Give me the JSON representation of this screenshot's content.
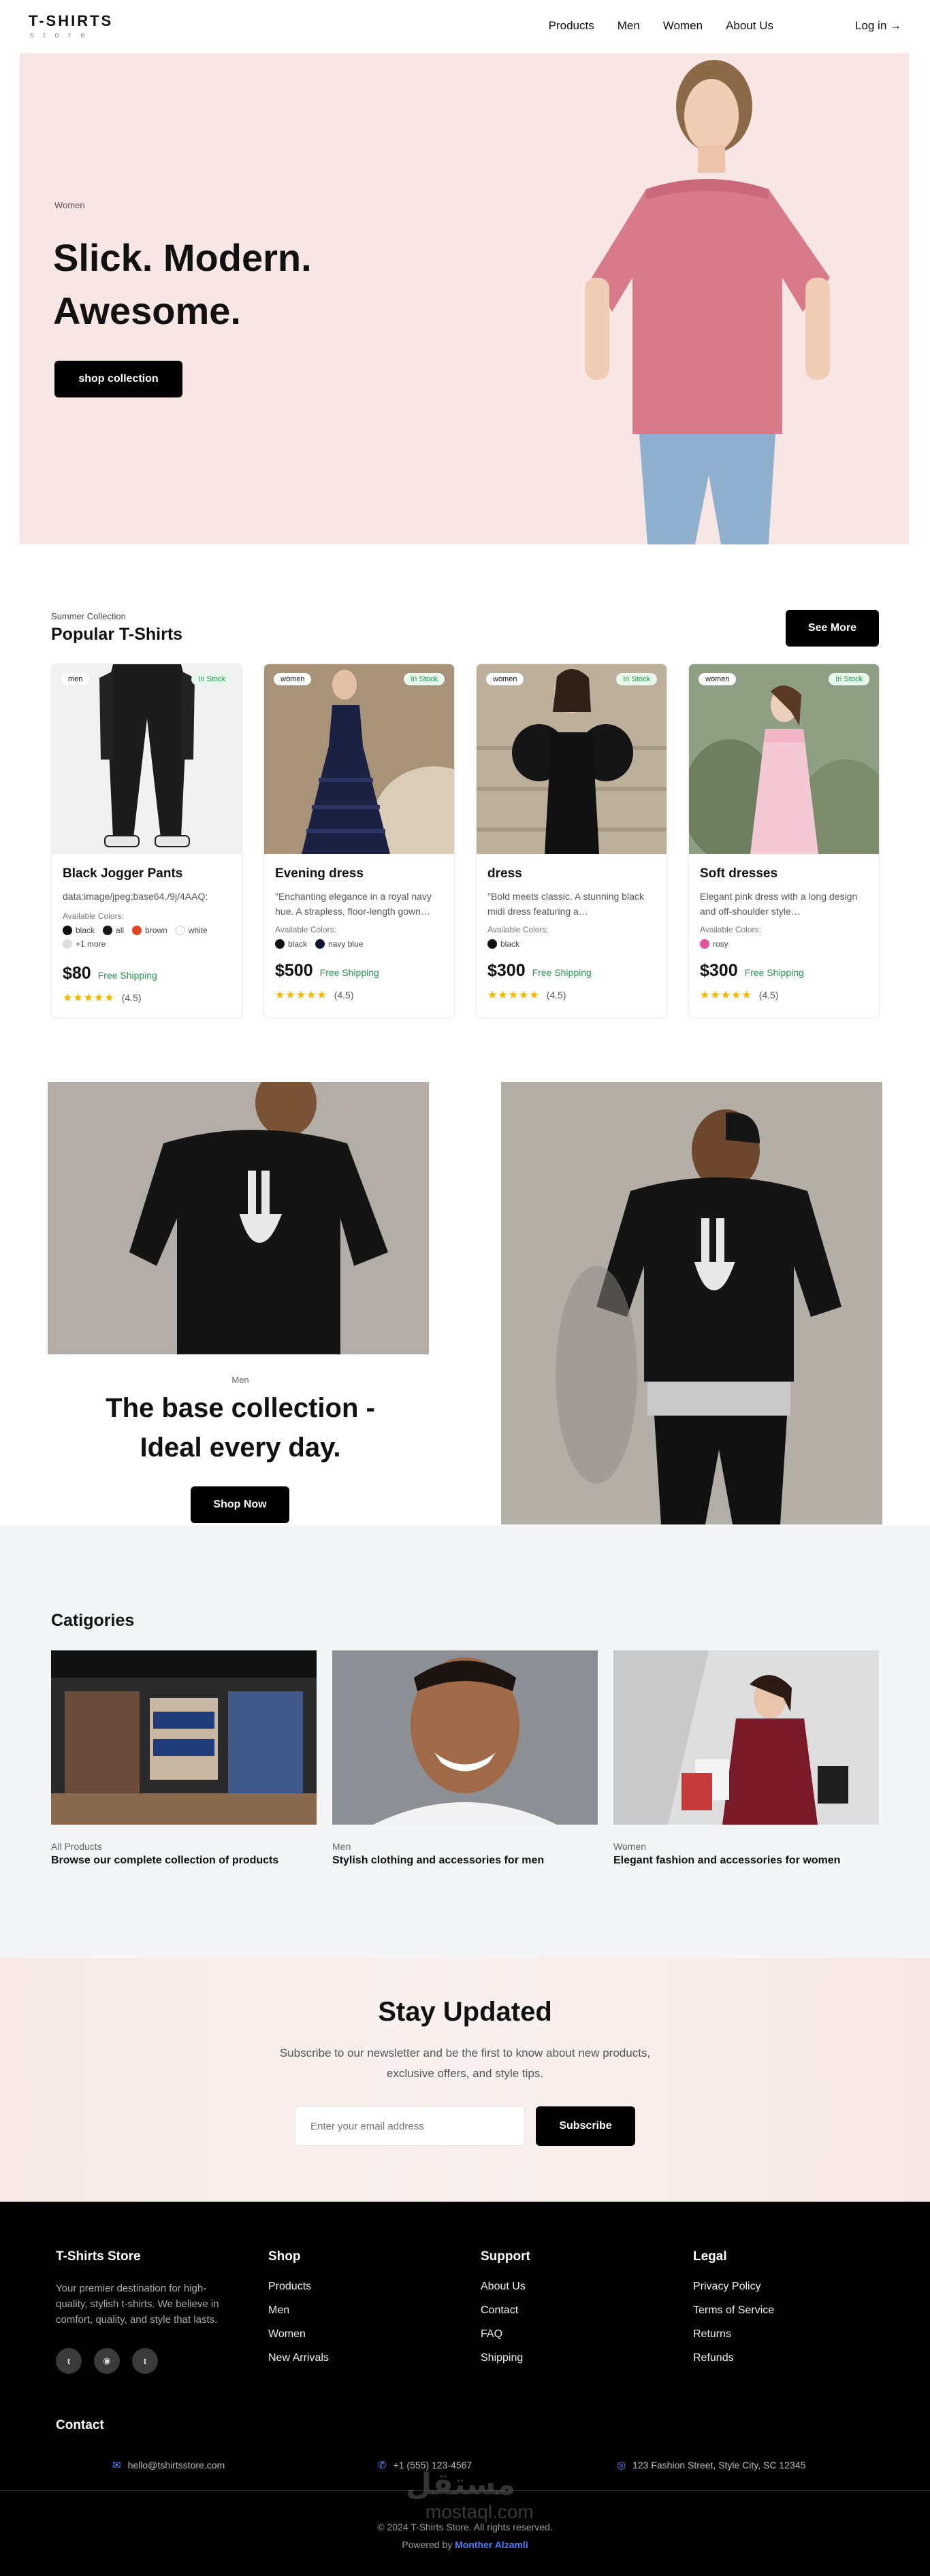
{
  "brand": {
    "name": "T-SHIRTS",
    "sub": "store"
  },
  "nav": {
    "links": [
      "Products",
      "Men",
      "Women",
      "About Us"
    ],
    "login": "Log in →"
  },
  "hero": {
    "tag": "Women",
    "title_line1": "Slick. Modern.",
    "title_line2": "Awesome.",
    "button": "shop collection"
  },
  "popular": {
    "subtitle": "Summer Collection",
    "title": "Popular T-Shirts",
    "see_more": "See More",
    "colors_label": "Available Colors:",
    "products": [
      {
        "tag": "men",
        "stock": "In Stock",
        "name": "Black Jogger Pants",
        "desc": "data:image/jpeg;base64,/9j/4AAQ:",
        "colors": [
          {
            "name": "black",
            "hex": "#111111"
          },
          {
            "name": "all",
            "hex": "#1a1a1a"
          },
          {
            "name": "brown",
            "hex": "#e0461f"
          },
          {
            "name": "white",
            "hex": "#ffffff"
          },
          {
            "name": "+1 more",
            "hex": "#dddddd"
          }
        ],
        "price": "$80",
        "shipping": "Free Shipping",
        "rating": "(4.5)",
        "stars": "★★★★★"
      },
      {
        "tag": "women",
        "stock": "In Stock",
        "name": "Evening dress",
        "desc": "\"Enchanting elegance in a royal navy hue. A strapless, floor-length gown…",
        "colors": [
          {
            "name": "black",
            "hex": "#111111"
          },
          {
            "name": "navy blue",
            "hex": "#0c1533"
          }
        ],
        "price": "$500",
        "shipping": "Free Shipping",
        "rating": "(4.5)",
        "stars": "★★★★★"
      },
      {
        "tag": "women",
        "stock": "In Stock",
        "name": "dress",
        "desc": "\"Bold meets classic. A stunning black midi dress featuring a…",
        "colors": [
          {
            "name": "black",
            "hex": "#111111"
          }
        ],
        "price": "$300",
        "shipping": "Free Shipping",
        "rating": "(4.5)",
        "stars": "★★★★★"
      },
      {
        "tag": "women",
        "stock": "In Stock",
        "name": "Soft dresses",
        "desc": "Elegant pink dress with a long design and off-shoulder style…",
        "colors": [
          {
            "name": "rosy",
            "hex": "#e2519a"
          }
        ],
        "price": "$300",
        "shipping": "Free Shipping",
        "rating": "(4.5)",
        "stars": "★★★★★"
      }
    ]
  },
  "promo": {
    "tag": "Men",
    "title_line1": "The base collection -",
    "title_line2": "Ideal every day.",
    "button": "Shop Now"
  },
  "categories": {
    "title": "Catigories",
    "items": [
      {
        "sub": "All Products",
        "desc": "Browse our complete collection of products"
      },
      {
        "sub": "Men",
        "desc": "Stylish clothing and accessories for men"
      },
      {
        "sub": "Women",
        "desc": "Elegant fashion and accessories for women"
      }
    ]
  },
  "newsletter": {
    "title": "Stay Updated",
    "text": "Subscribe to our newsletter and be the first to know about new products, exclusive offers, and style tips.",
    "placeholder": "Enter your email address",
    "button": "Subscribe"
  },
  "footer": {
    "store": {
      "title": "T-Shirts Store",
      "about": "Your premier destination for high-quality, stylish t-shirts. We believe in comfort, quality, and style that lasts."
    },
    "shop": {
      "title": "Shop",
      "links": [
        "Products",
        "Men",
        "Women",
        "New Arrivals"
      ]
    },
    "support": {
      "title": "Support",
      "links": [
        "About Us",
        "Contact",
        "FAQ",
        "Shipping"
      ]
    },
    "legal": {
      "title": "Legal",
      "links": [
        "Privacy Policy",
        "Terms of Service",
        "Returns",
        "Refunds"
      ]
    },
    "contact": {
      "title": "Contact",
      "email": "hello@tshirtsstore.com",
      "phone": "+1 (555) 123-4567",
      "address": "123 Fashion Street, Style City, SC 12345"
    },
    "copyright": "© 2024 T-Shirts Store. All rights reserved.",
    "powered_prefix": "Powered by",
    "powered_author": "Monther Alzamli",
    "watermark": "مستقل",
    "watermark_sub": "mostaql.com"
  }
}
